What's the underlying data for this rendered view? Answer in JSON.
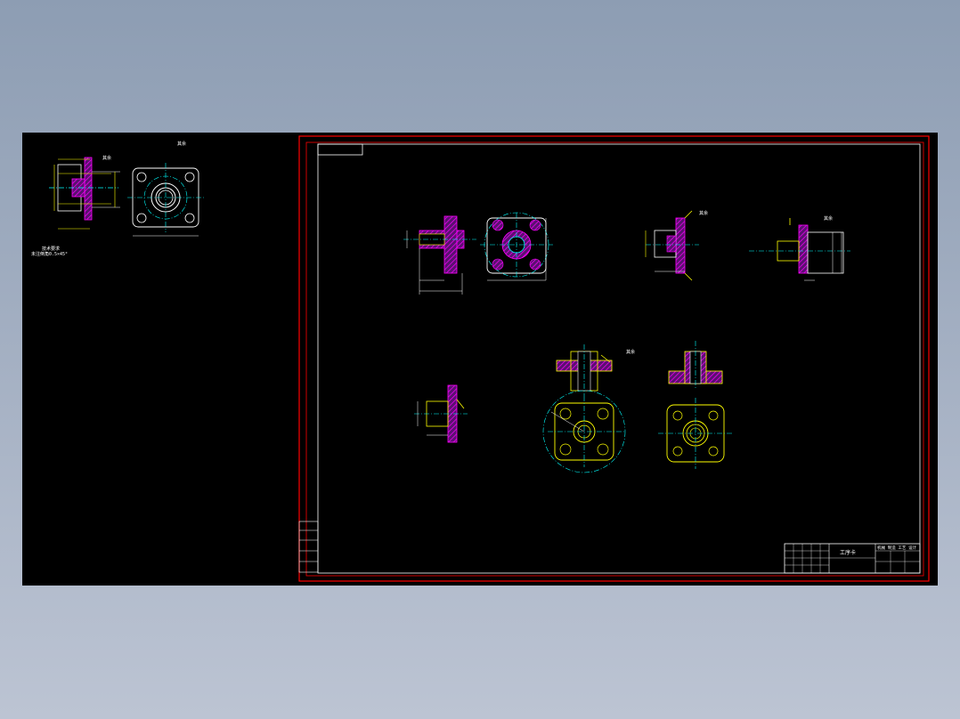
{
  "viewer": {
    "background": "#000000",
    "frame_color": "#ff0000",
    "border_color": "#ffffff"
  },
  "colors": {
    "outline": "#ffff00",
    "hatch": "#ff00ff",
    "hatch_fill": "#7a1f8a",
    "center": "#00ffff",
    "dimension": "#ffffff",
    "part_outline": "#ffffff"
  },
  "title_block": {
    "drawing_name": "工序卡",
    "org_text": "机械 制造 工艺 设计"
  }
}
